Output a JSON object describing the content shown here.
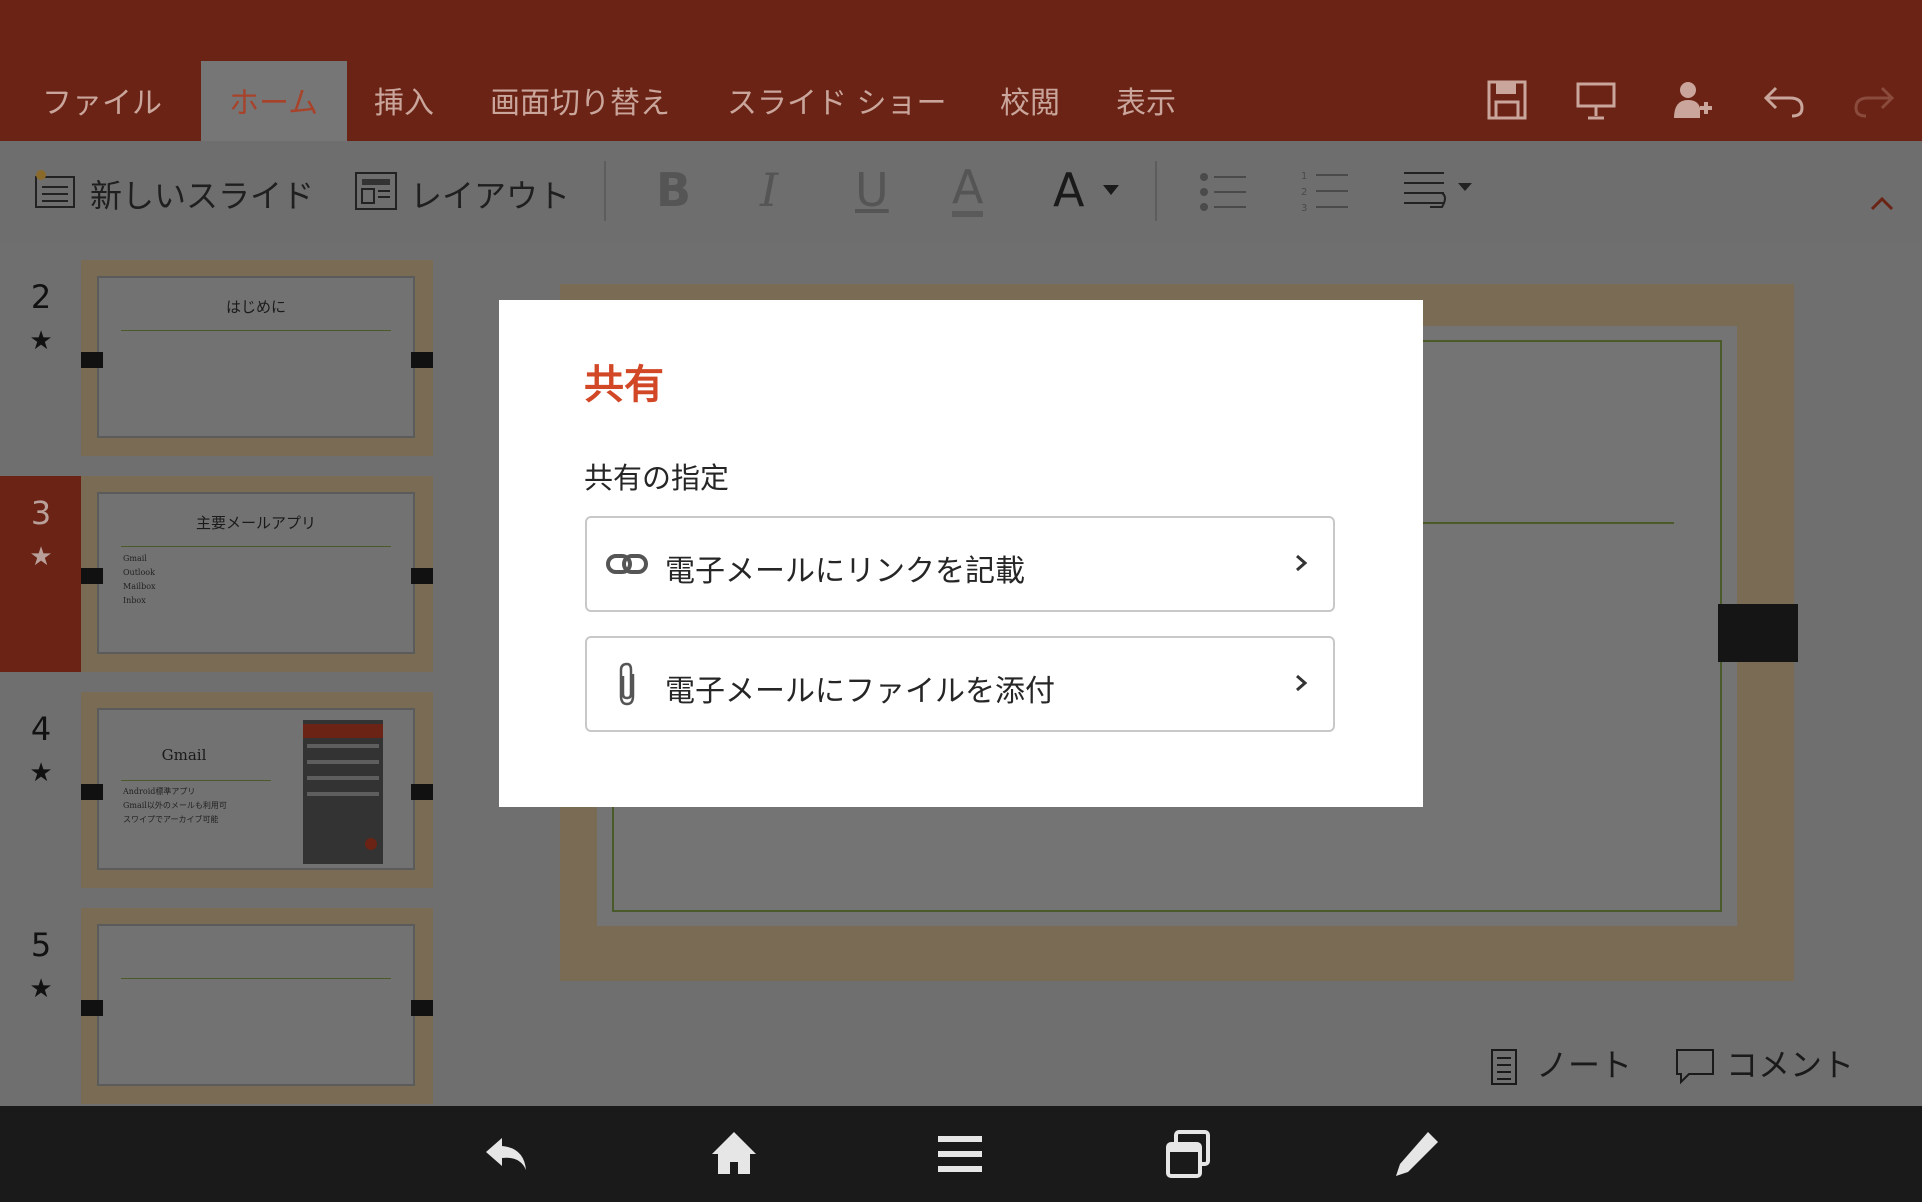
{
  "ribbon": {
    "tabs": [
      "ファイル",
      "ホーム",
      "挿入",
      "画面切り替え",
      "スライド ショー",
      "校閲",
      "表示"
    ],
    "active_tab": "ホーム",
    "colors": {
      "accent": "#d24726",
      "ribbon_bg": "#6a2314",
      "dim_overlay": "#6e6e6e"
    }
  },
  "toolbar": {
    "new_slide_label": "新しいスライド",
    "layout_label": "レイアウト",
    "bold": "B",
    "italic": "I",
    "underline": "U",
    "font_color": "A",
    "font_size": "A"
  },
  "slides": [
    {
      "number": "2",
      "star": "★",
      "title": "はじめに",
      "bullets": []
    },
    {
      "number": "3",
      "star": "★",
      "title": "主要メールアプリ",
      "bullets": [
        "Gmail",
        "Outlook",
        "Mailbox",
        "Inbox"
      ],
      "selected": true
    },
    {
      "number": "4",
      "star": "★",
      "title": "Gmail",
      "bullets": [
        "Android標準アプリ",
        "Gmail以外のメールも利用可",
        "スワイプでアーカイブ可能"
      ]
    },
    {
      "number": "5",
      "star": "★",
      "title": "",
      "bullets": []
    }
  ],
  "bottom_bar": {
    "notes_label": "ノート",
    "comments_label": "コメント"
  },
  "dialog": {
    "title": "共有",
    "subtitle": "共有の指定",
    "options": [
      {
        "label": "電子メールにリンクを記載",
        "icon": "link-icon"
      },
      {
        "label": "電子メールにファイルを添付",
        "icon": "paperclip-icon"
      }
    ]
  },
  "nav": {
    "icons": [
      "back-icon",
      "home-icon",
      "menu-icon",
      "recent-apps-icon",
      "pen-icon"
    ]
  }
}
